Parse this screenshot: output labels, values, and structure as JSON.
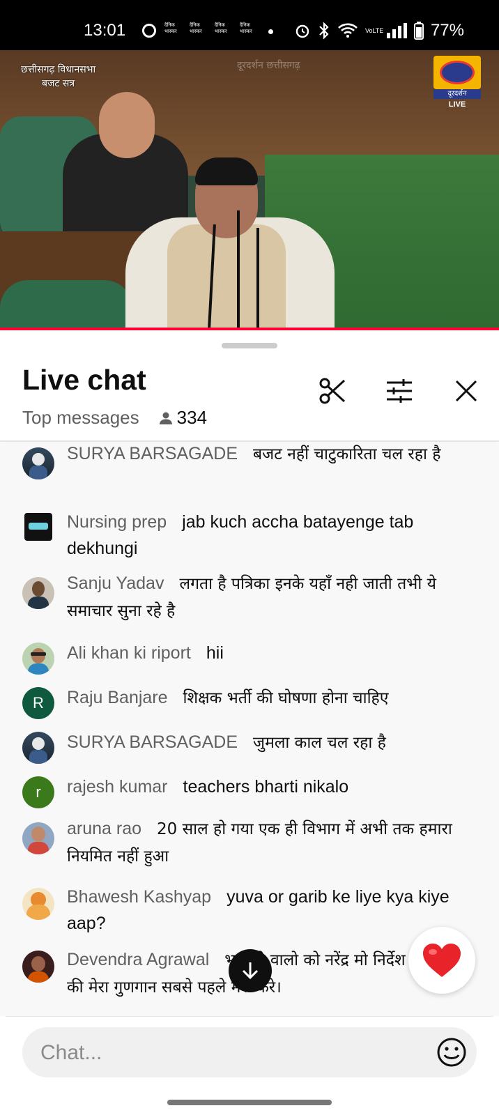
{
  "status_bar": {
    "time": "13:01",
    "notifications": [
      "दैनिक भास्कर",
      "दैनिक भास्कर",
      "दैनिक भास्कर",
      "दैनिक भास्कर"
    ],
    "battery": "77%",
    "network": "VoLTE"
  },
  "video": {
    "caption_line1": "छत्तीसगढ़ विधानसभा",
    "caption_line2": "बजट सत्र",
    "watermark": "दूरदर्शन छत्तीसगढ़",
    "channel_name": "दूरदर्शन",
    "live_badge": "LIVE"
  },
  "chat": {
    "title": "Live chat",
    "mode": "Top messages",
    "viewer_count": "334",
    "input_placeholder": "Chat...",
    "messages": [
      {
        "author": "SURYA BARSAGADE",
        "text": "बजट नहीं चाटुकारिता चल रहा है"
      },
      {
        "author": "Nursing prep",
        "text": "jab kuch accha batayenge tab dekhungi"
      },
      {
        "author": "Sanju Yadav",
        "text": "लगता है पत्रिका इनके यहाँ नही जाती तभी ये समाचार सुना रहे है"
      },
      {
        "author": "Ali khan ki riport",
        "text": "hii"
      },
      {
        "author": "Raju Banjare",
        "text": "शिक्षक भर्ती की घोषणा होना चाहिए",
        "avatar_letter": "R"
      },
      {
        "author": "SURYA BARSAGADE",
        "text": "जुमला काल चल रहा है"
      },
      {
        "author": "rajesh kumar",
        "text": "teachers bharti nikalo",
        "avatar_letter": "r"
      },
      {
        "author": "aruna rao",
        "text": "20 साल हो गया एक ही विभाग में अभी तक हमारा नियमित नहीं हुआ"
      },
      {
        "author": "Bhawesh Kashyap",
        "text": "yuva or garib ke liye kya kiye aap?"
      },
      {
        "author": "Devendra Agrawal",
        "text": "भाजपी वालो को नरेंद्र मो निर्देश रहता है की मेरा गुणगान सबसे पहले मेरा करे।"
      }
    ]
  },
  "colors": {
    "accent_red": "#ff0033",
    "avatar_green": "#0f5a3e",
    "avatar_green2": "#3a7a1a",
    "text_primary": "#0f0f0f",
    "text_secondary": "#606060"
  },
  "icons": {
    "clip": "scissors-icon",
    "filter": "sliders-icon",
    "close": "close-icon",
    "scroll_down": "arrow-down-icon",
    "reaction": "heart-icon",
    "emoji": "smiley-icon"
  }
}
